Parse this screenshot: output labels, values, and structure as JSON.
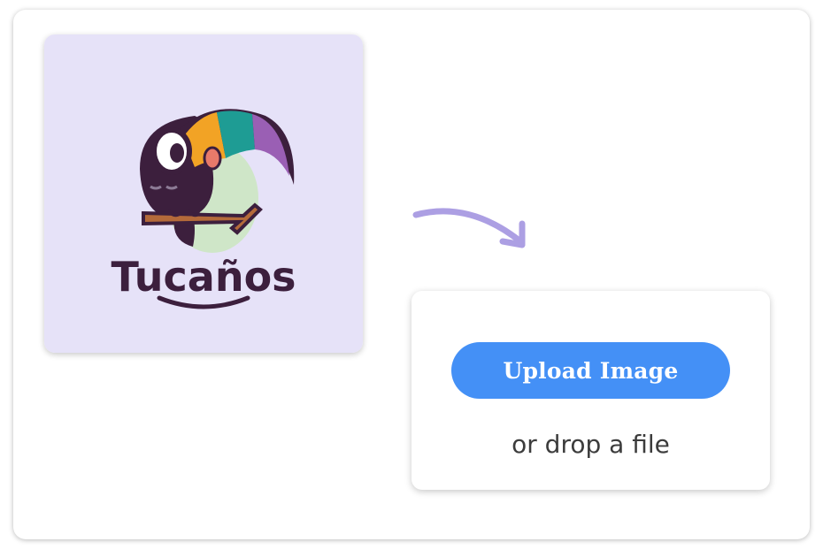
{
  "colors": {
    "logo_background": "#e6e2f8",
    "button_background": "#4490f6",
    "arrow": "#ac9fe3",
    "brand_dark": "#3c1f3d"
  },
  "logo": {
    "wordmark": "Tucaños",
    "icon": "toucan-on-branch-icon"
  },
  "upload": {
    "button_label": "Upload Image",
    "drop_hint": "or drop a file"
  },
  "arrow_icon": "curved-arrow-down-right-icon"
}
